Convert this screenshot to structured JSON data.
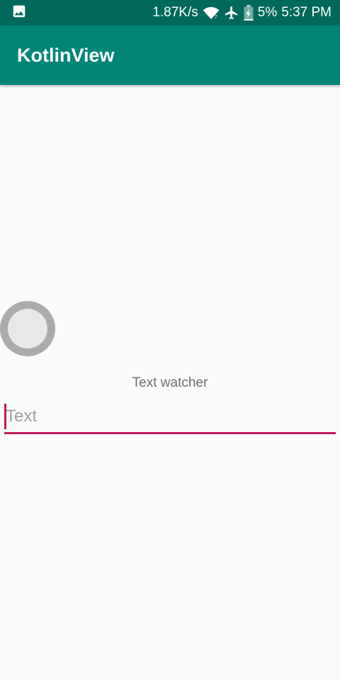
{
  "status_bar": {
    "network_speed": "1.87K/s",
    "battery_percent": "5%",
    "time": "5:37 PM",
    "icons": [
      "image-notification-icon",
      "wifi-icon",
      "airplane-mode-icon",
      "battery-charging-icon"
    ]
  },
  "app_bar": {
    "title": "KotlinView"
  },
  "main": {
    "text_watcher_label": "Text watcher",
    "text_input": {
      "placeholder": "Text",
      "value": ""
    }
  },
  "colors": {
    "status_bar": "#00695c",
    "app_bar": "#008577",
    "accent": "#c2185b",
    "background": "#fafafa"
  }
}
